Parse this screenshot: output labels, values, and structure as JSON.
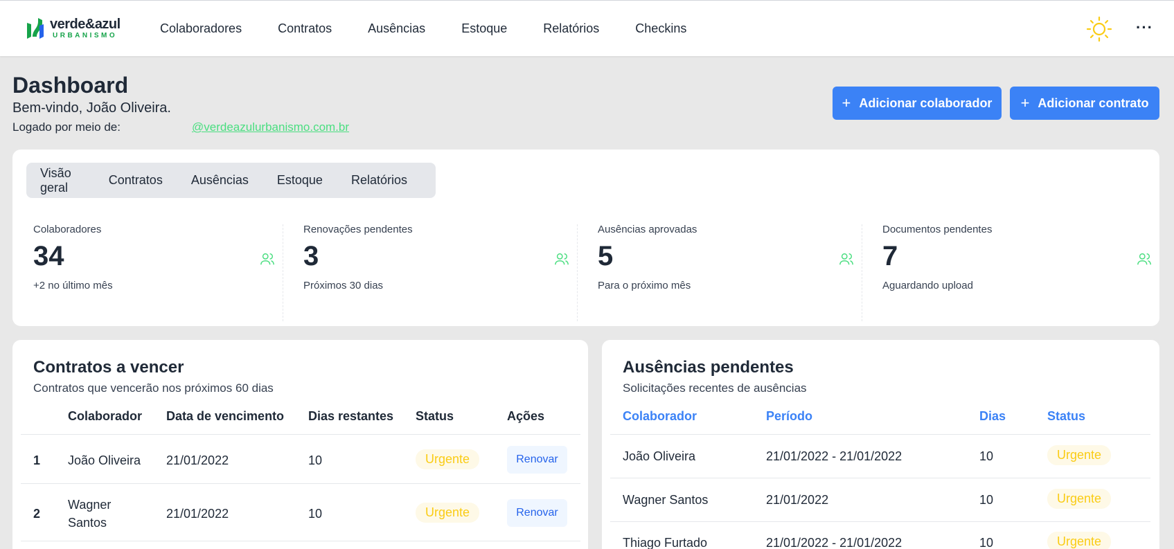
{
  "brand": {
    "name": "verde&azul",
    "sub": "URBANISMO",
    "color": "#16a34a"
  },
  "nav": [
    "Colaboradores",
    "Contratos",
    "Ausências",
    "Estoque",
    "Relatórios",
    "Checkins"
  ],
  "topbar_icons": {
    "theme": "sun-icon",
    "more": "···"
  },
  "header": {
    "title": "Dashboard",
    "welcome": "Bem-vindo, João Oliveira.",
    "logged_label": "Logado por meio de:",
    "email": "@verdeazulurbanismo.com.br",
    "btn_add_collaborator": "Adicionar colaborador",
    "btn_add_contract": "Adicionar contrato"
  },
  "tabs": [
    "Visão geral",
    "Contratos",
    "Ausências",
    "Estoque",
    "Relatórios"
  ],
  "stats": [
    {
      "label": "Colaboradores",
      "value": "34",
      "sub": "+2 no último mês"
    },
    {
      "label": "Renovações pendentes",
      "value": "3",
      "sub": "Próximos 30 dias"
    },
    {
      "label": "Ausências aprovadas",
      "value": "5",
      "sub": "Para o próximo mês"
    },
    {
      "label": "Documentos pendentes",
      "value": "7",
      "sub": "Aguardando upload"
    }
  ],
  "contracts": {
    "title": "Contratos a vencer",
    "subtitle": "Contratos que vencerão nos próximos 60 dias",
    "columns": [
      "Colaborador",
      "Data de vencimento",
      "Dias restantes",
      "Status",
      "Ações"
    ],
    "rows": [
      {
        "index": "1",
        "name": "João Oliveira",
        "date": "21/01/2022",
        "days": "10",
        "status": "Urgente",
        "action": "Renovar"
      },
      {
        "index": "2",
        "name": "Wagner Santos",
        "date": "21/01/2022",
        "days": "10",
        "status": "Urgente",
        "action": "Renovar"
      }
    ]
  },
  "absences": {
    "title": "Ausências pendentes",
    "subtitle": "Solicitações recentes de ausências",
    "columns": [
      "Colaborador",
      "Período",
      "Dias",
      "Status"
    ],
    "rows": [
      {
        "name": "João Oliveira",
        "period": "21/01/2022 - 21/01/2022",
        "days": "10",
        "status": "Urgente"
      },
      {
        "name": "Wagner Santos",
        "period": "21/01/2022",
        "days": "10",
        "status": "Urgente"
      },
      {
        "name": "Thiago Furtado",
        "period": "21/01/2022 - 21/01/2022",
        "days": "10",
        "status": "Urgente"
      }
    ]
  },
  "colors": {
    "primary": "#3b82f6",
    "accent_green": "#4ade80",
    "urgent": "#facc15",
    "background": "#e8e8e8"
  }
}
